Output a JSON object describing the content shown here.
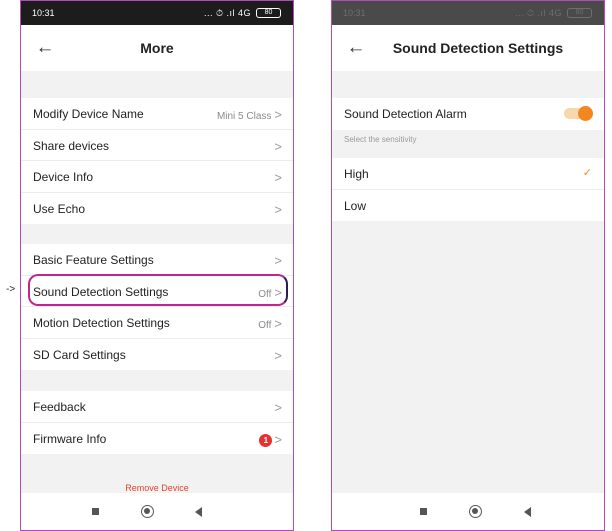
{
  "left_screen": {
    "status_time": "10:31",
    "status_icons": "... ⏱ .ıl 4G",
    "battery": "80",
    "title": "More",
    "group1": [
      {
        "label": "Modify Device Name",
        "value": "Mini 5 Class"
      },
      {
        "label": "Share devices",
        "value": ""
      },
      {
        "label": "Device Info",
        "value": ""
      },
      {
        "label": "Use Echo",
        "value": ""
      }
    ],
    "group2": [
      {
        "label": "Basic Feature Settings",
        "value": ""
      },
      {
        "label": "Sound Detection Settings",
        "value": "Off"
      },
      {
        "label": "Motion Detection Settings",
        "value": "Off"
      },
      {
        "label": "SD Card Settings",
        "value": ""
      }
    ],
    "group3": [
      {
        "label": "Feedback",
        "value": ""
      },
      {
        "label": "Firmware Info",
        "badge": "1"
      }
    ],
    "remove_device": "Remove Device",
    "pointer_arrow": "->"
  },
  "right_screen": {
    "status_time": "10:31",
    "status_icons": "... ⏱ .ıl 4G",
    "battery": "80",
    "title": "Sound Detection Settings",
    "alarm_label": "Sound Detection Alarm",
    "alarm_enabled": true,
    "section_label": "Select the sensitivity",
    "options": [
      {
        "label": "High",
        "selected": true
      },
      {
        "label": "Low",
        "selected": false
      }
    ]
  },
  "icons": {
    "back": "back-arrow-icon",
    "chevron": "chevron-right-icon",
    "check": "check-icon",
    "nav": [
      "square-icon",
      "circle-icon",
      "triangle-back-icon"
    ]
  },
  "colors": {
    "accent_orange": "#f2871f",
    "remove_red": "#e0452f",
    "badge_red": "#e4332e",
    "frame_magenta": "#b44bb8"
  }
}
